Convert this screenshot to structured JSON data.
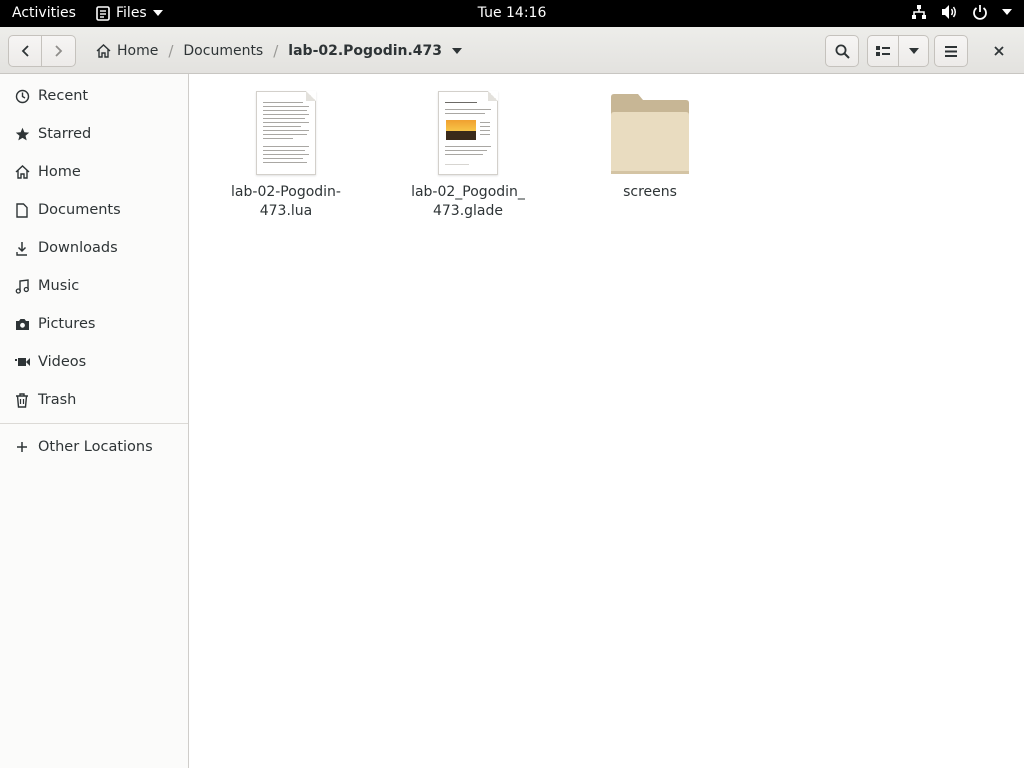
{
  "topbar": {
    "activities": "Activities",
    "app_name": "Files",
    "clock": "Tue 14:16"
  },
  "headerbar": {
    "breadcrumbs": [
      "Home",
      "Documents",
      "lab-02.Pogodin.473"
    ],
    "separator": "/"
  },
  "sidebar": {
    "items": [
      {
        "label": "Recent",
        "icon": "clock-icon"
      },
      {
        "label": "Starred",
        "icon": "star-icon"
      },
      {
        "label": "Home",
        "icon": "home-icon"
      },
      {
        "label": "Documents",
        "icon": "document-icon"
      },
      {
        "label": "Downloads",
        "icon": "download-icon"
      },
      {
        "label": "Music",
        "icon": "music-icon"
      },
      {
        "label": "Pictures",
        "icon": "camera-icon"
      },
      {
        "label": "Videos",
        "icon": "video-icon"
      },
      {
        "label": "Trash",
        "icon": "trash-icon"
      }
    ],
    "other_locations": {
      "label": "Other Locations",
      "icon": "plus-icon"
    }
  },
  "files": [
    {
      "name_line1": "lab-02-Pogodin-",
      "name_line2": "473.lua",
      "type": "text-file"
    },
    {
      "name_line1": "lab-02_Pogodin_",
      "name_line2": "473.glade",
      "type": "glade-file"
    },
    {
      "name_line1": "screens",
      "name_line2": "",
      "type": "folder"
    }
  ],
  "colors": {
    "topbar_bg": "#000000",
    "folder_front": "#e9dcc0",
    "folder_back": "#c7b695",
    "text": "#2e3436"
  }
}
